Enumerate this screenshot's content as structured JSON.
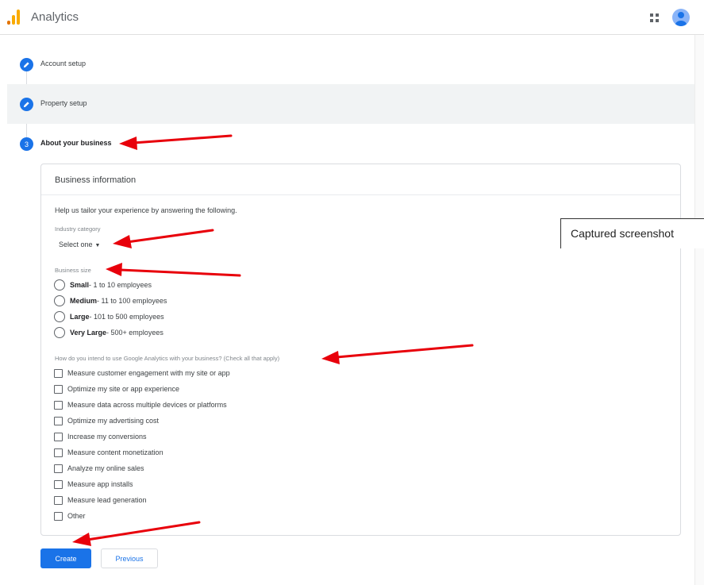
{
  "header": {
    "app_title": "Analytics",
    "logo_icon": "analytics-logo",
    "apps_icon": "apps-grid-icon",
    "avatar_icon": "account-avatar"
  },
  "steps": [
    {
      "number": "",
      "label": "Account setup",
      "state": "edit"
    },
    {
      "number": "",
      "label": "Property setup",
      "state": "edit"
    },
    {
      "number": "3",
      "label": "About your business",
      "state": "current"
    }
  ],
  "card": {
    "title": "Business information",
    "help_text": "Help us tailor your experience by answering the following.",
    "industry_label": "Industry category",
    "industry_value": "Select one",
    "size_label": "Business size",
    "sizes": [
      {
        "name": "Small",
        "range": " - 1 to 10 employees"
      },
      {
        "name": "Medium",
        "range": " - 11 to 100 employees"
      },
      {
        "name": "Large",
        "range": " - 101 to 500 employees"
      },
      {
        "name": "Very Large",
        "range": " - 500+ employees"
      }
    ],
    "usage_label": "How do you intend to use Google Analytics with your business? (Check all that apply)",
    "usage_options": [
      "Measure customer engagement with my site or app",
      "Optimize my site or app experience",
      "Measure data across multiple devices or platforms",
      "Optimize my advertising cost",
      "Increase my conversions",
      "Measure content monetization",
      "Analyze my online sales",
      "Measure app installs",
      "Measure lead generation",
      "Other"
    ]
  },
  "buttons": {
    "create": "Create",
    "previous": "Previous"
  },
  "tooltip": "Captured screenshot",
  "colors": {
    "accent": "#1a73e8",
    "arrow": "#e8000b",
    "logo_orange": "#f9ab00",
    "logo_dark": "#e37400"
  }
}
